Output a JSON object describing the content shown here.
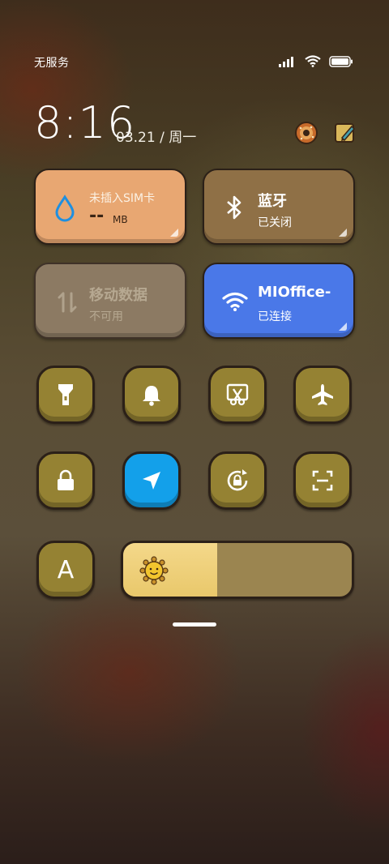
{
  "status": {
    "carrier": "无服务"
  },
  "header": {
    "time": "8:16",
    "date": "03.21 / 周一"
  },
  "tiles": {
    "sim": {
      "title": "未插入SIM卡",
      "value": "--",
      "unit": "MB"
    },
    "bluetooth": {
      "title": "蓝牙",
      "status": "已关闭"
    },
    "mobile_data": {
      "title": "移动数据",
      "status": "不可用"
    },
    "wifi": {
      "title": "MIOffice-",
      "status": "已连接"
    }
  },
  "font_button": {
    "label": "A"
  },
  "brightness": {
    "level": 0.41
  },
  "colors": {
    "accent_blue": "#4a78e8",
    "location_active": "#13a0ea",
    "button": "#958233",
    "sim_tile": "#e8a772"
  }
}
